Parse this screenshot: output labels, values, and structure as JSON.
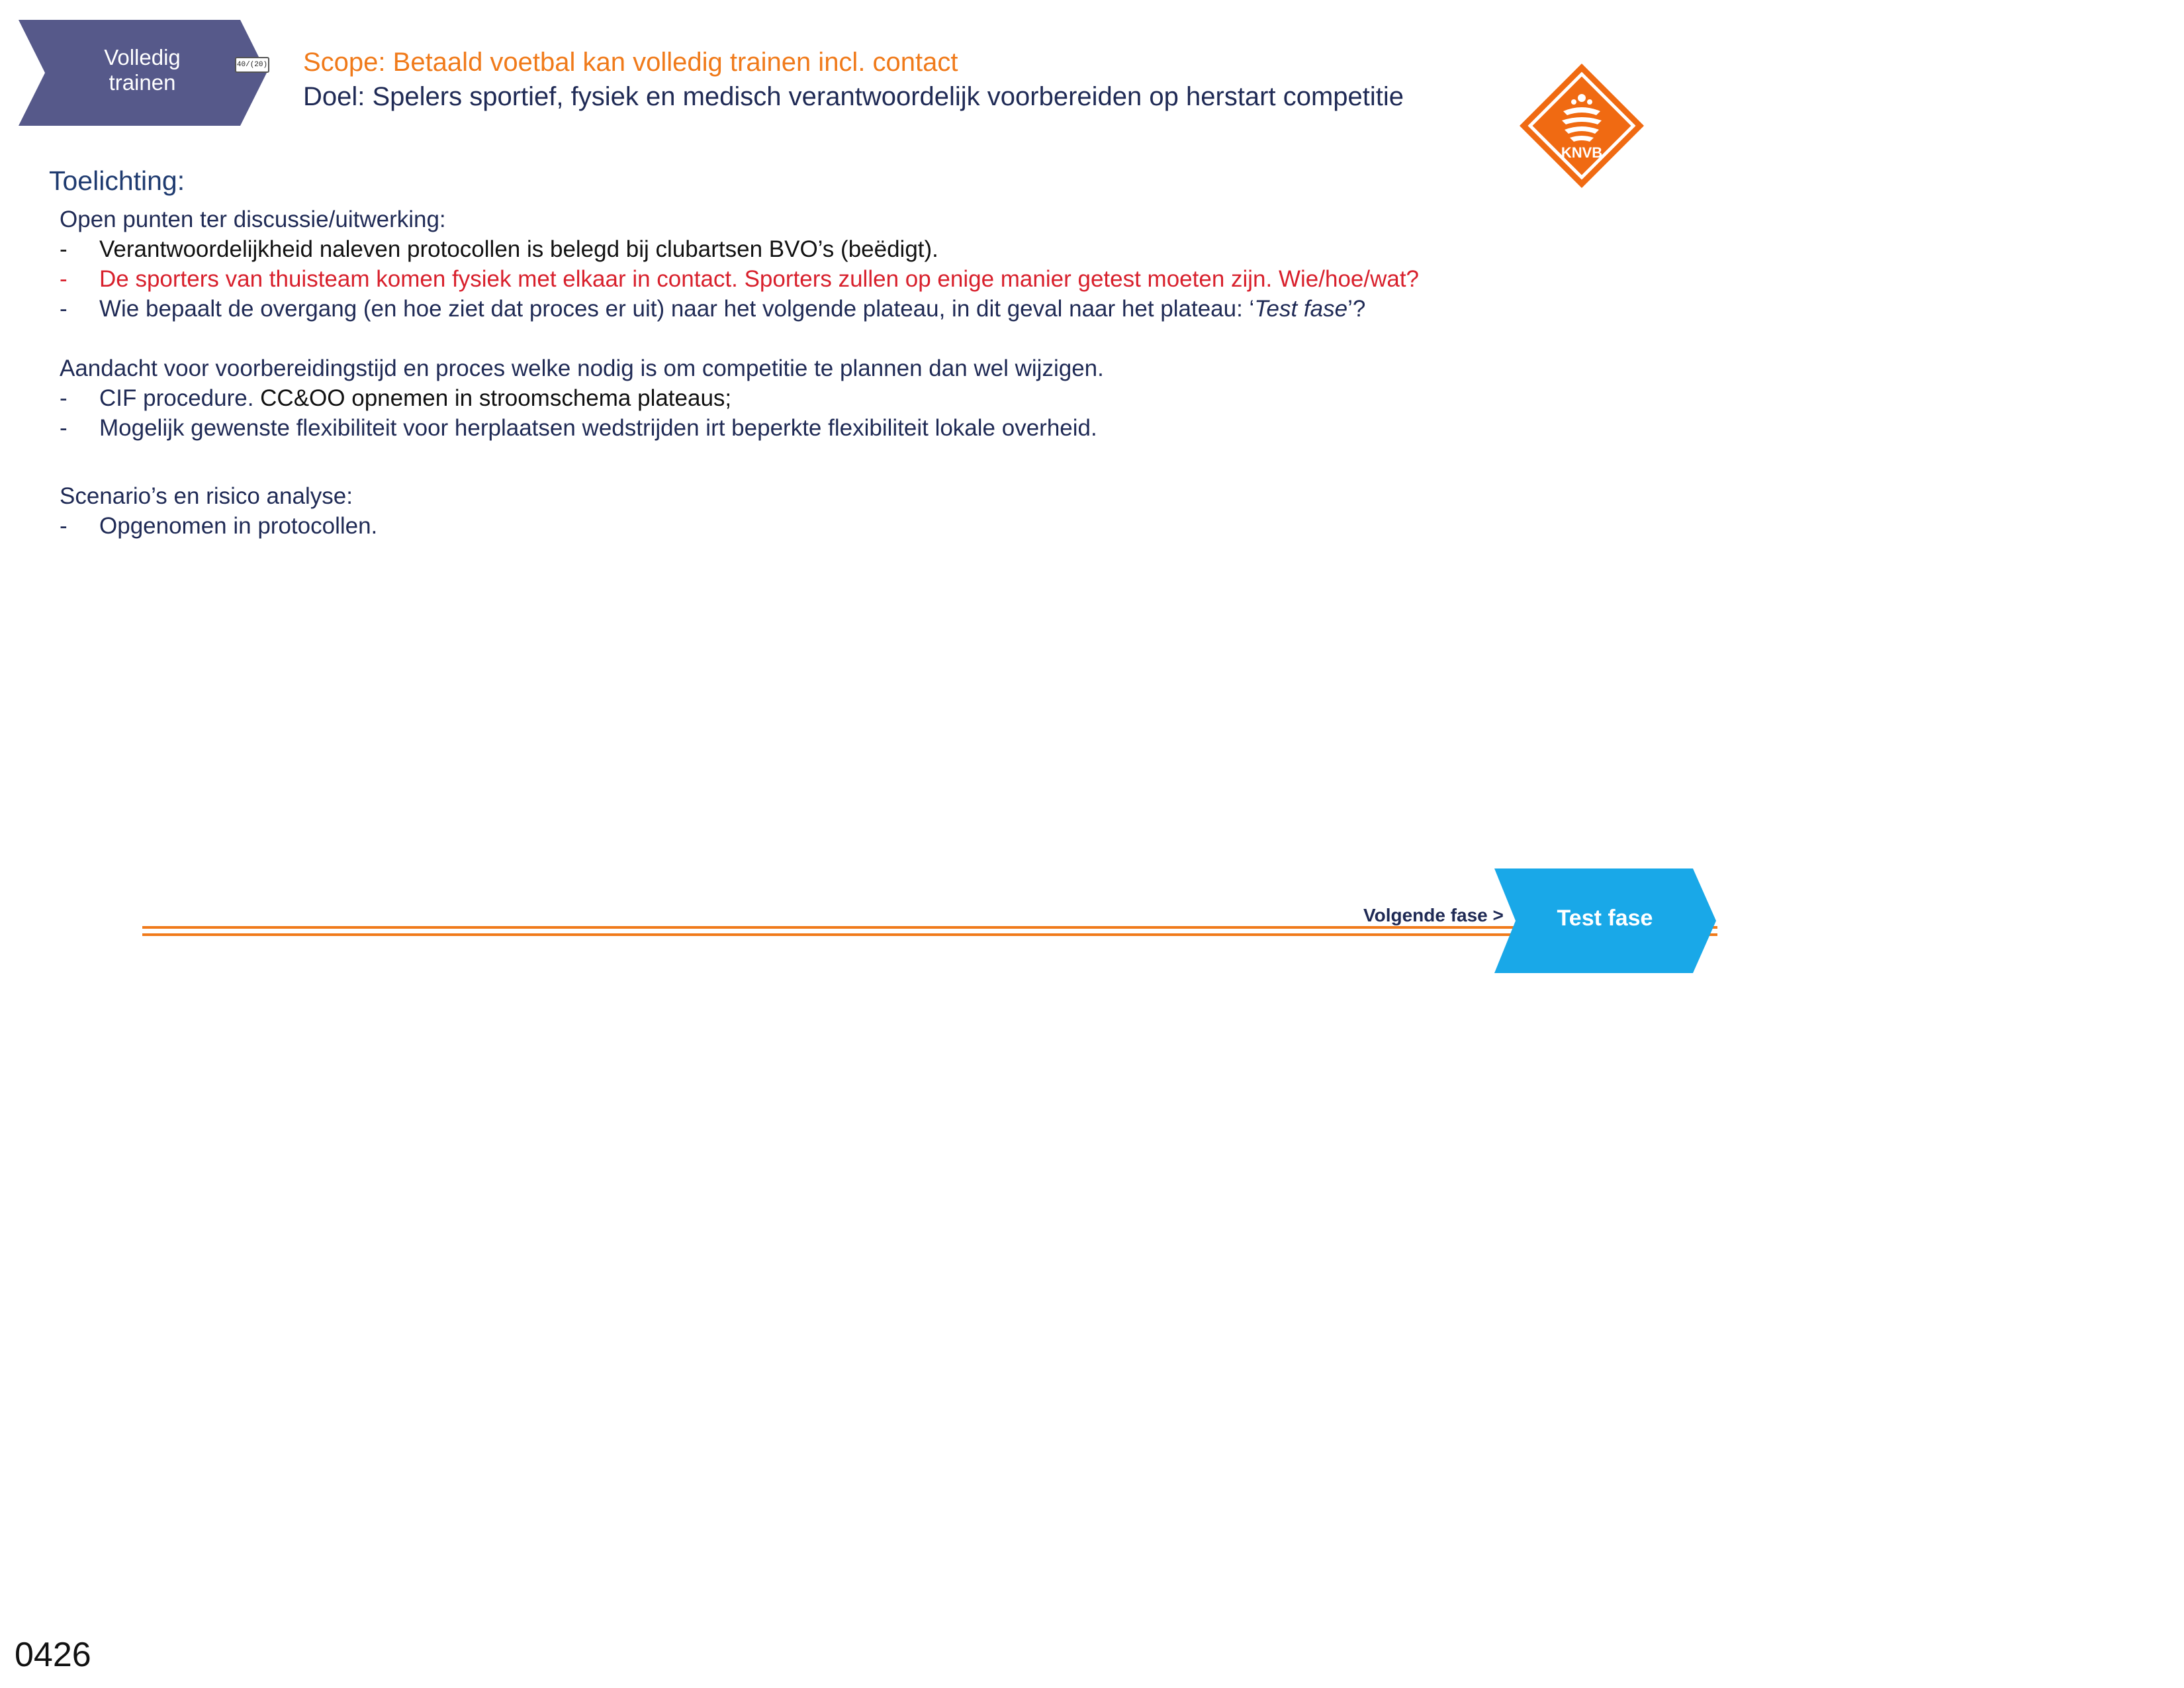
{
  "colors": {
    "phase_chevron": "#56598a",
    "scope_text": "#f07a1a",
    "goal_text": "#1f2a55",
    "logo_orange": "#f06a12",
    "timeline_orange": "#f07a1a",
    "next_chevron": "#19a8e8",
    "highlight_red": "#d8202c"
  },
  "header": {
    "phase_label": "Volledig\ntrainen",
    "phase_tag": "40/(20)",
    "scope": "Scope: Betaald voetbal kan volledig trainen incl. contact",
    "goal": "Doel: Spelers sportief, fysiek en medisch verantwoordelijk voorbereiden op herstart competitie",
    "logo_text": "KNVB",
    "logo_icon": "lion-crest-icon"
  },
  "body": {
    "section_title": "Toelichting:",
    "open_points": {
      "intro": "Open punten ter discussie/uitwerking:",
      "bullets": [
        {
          "dash": "-",
          "text": "Verantwoordelijkheid naleven protocollen is belegd bij clubartsen BVO’s (beëdigt)."
        },
        {
          "dash": "-",
          "text": "De sporters van thuisteam komen fysiek met elkaar in contact. Sporters zullen op enige manier getest moeten zijn. Wie/hoe/wat?"
        },
        {
          "dash": "-",
          "text_before": "Wie bepaalt de overgang (en hoe ziet dat proces er uit) naar het volgende plateau, in dit geval naar het plateau: ‘",
          "text_italic": "Test fase",
          "text_after": "’?"
        }
      ]
    },
    "preparation": {
      "intro": "Aandacht voor voorbereidingstijd en proces welke nodig is om competitie te plannen dan wel wijzigen.",
      "bullets": [
        {
          "dash": "-",
          "text_a": "CIF procedure. ",
          "text_b": "CC&OO opnemen in stroomschema plateaus;"
        },
        {
          "dash": "-",
          "text": "Mogelijk gewenste flexibiliteit voor herplaatsen wedstrijden irt beperkte flexibiliteit lokale overheid."
        }
      ]
    },
    "scenarios": {
      "intro": "Scenario’s en risico analyse:",
      "bullets": [
        {
          "dash": "-",
          "text": "Opgenomen in protocollen."
        }
      ]
    }
  },
  "footer": {
    "next_label": "Volgende fase >",
    "next_button": "Test fase",
    "page_number": "0426"
  }
}
